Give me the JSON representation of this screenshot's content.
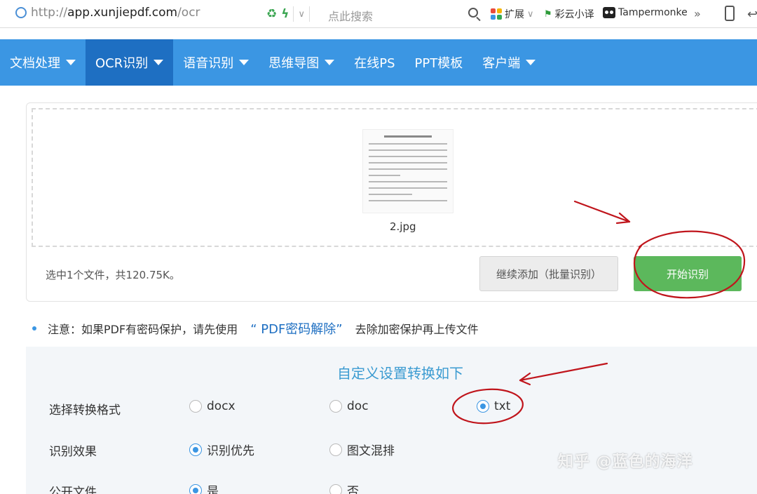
{
  "browser": {
    "url_scheme": "http://",
    "url_host": "app.xunjiepdf.com",
    "url_path": "/ocr",
    "search_placeholder": "点此搜索",
    "extensions": {
      "ext_label": "扩展",
      "caiyun_label": "彩云小译",
      "tampermonkey_label": "Tampermonke",
      "more": "»"
    }
  },
  "nav": {
    "items": [
      {
        "label": "文档处理",
        "dropdown": true
      },
      {
        "label": "OCR识别",
        "dropdown": true,
        "active": true
      },
      {
        "label": "语音识别",
        "dropdown": true
      },
      {
        "label": "思维导图",
        "dropdown": true
      },
      {
        "label": "在线PS",
        "dropdown": false
      },
      {
        "label": "PPT模板",
        "dropdown": false
      },
      {
        "label": "客户端",
        "dropdown": true
      }
    ]
  },
  "upload": {
    "file_name": "2.jpg",
    "selection_info": "选中1个文件，共120.75K。",
    "continue_button": "继续添加（批量识别）",
    "start_button": "开始识别"
  },
  "notice": {
    "prefix": "注意：如果PDF有密码保护，请先使用",
    "link": "“ PDF密码解除”",
    "suffix": "去除加密保护再上传文件"
  },
  "settings": {
    "title": "自定义设置转换如下",
    "rows": [
      {
        "label": "选择转换格式",
        "options": [
          {
            "label": "docx",
            "selected": false
          },
          {
            "label": "doc",
            "selected": false
          },
          {
            "label": "txt",
            "selected": true
          }
        ]
      },
      {
        "label": "识别效果",
        "options": [
          {
            "label": "识别优先",
            "selected": true
          },
          {
            "label": "图文混排",
            "selected": false
          }
        ]
      },
      {
        "label": "公开文件",
        "options": [
          {
            "label": "是",
            "selected": true
          },
          {
            "label": "否",
            "selected": false
          }
        ]
      }
    ]
  },
  "watermark": "知乎 @蓝色的海洋",
  "colors": {
    "nav_bg": "#3b96e3",
    "nav_active": "#1e6fc2",
    "start_button": "#5cb85c",
    "annotation_red": "#c0151c"
  }
}
